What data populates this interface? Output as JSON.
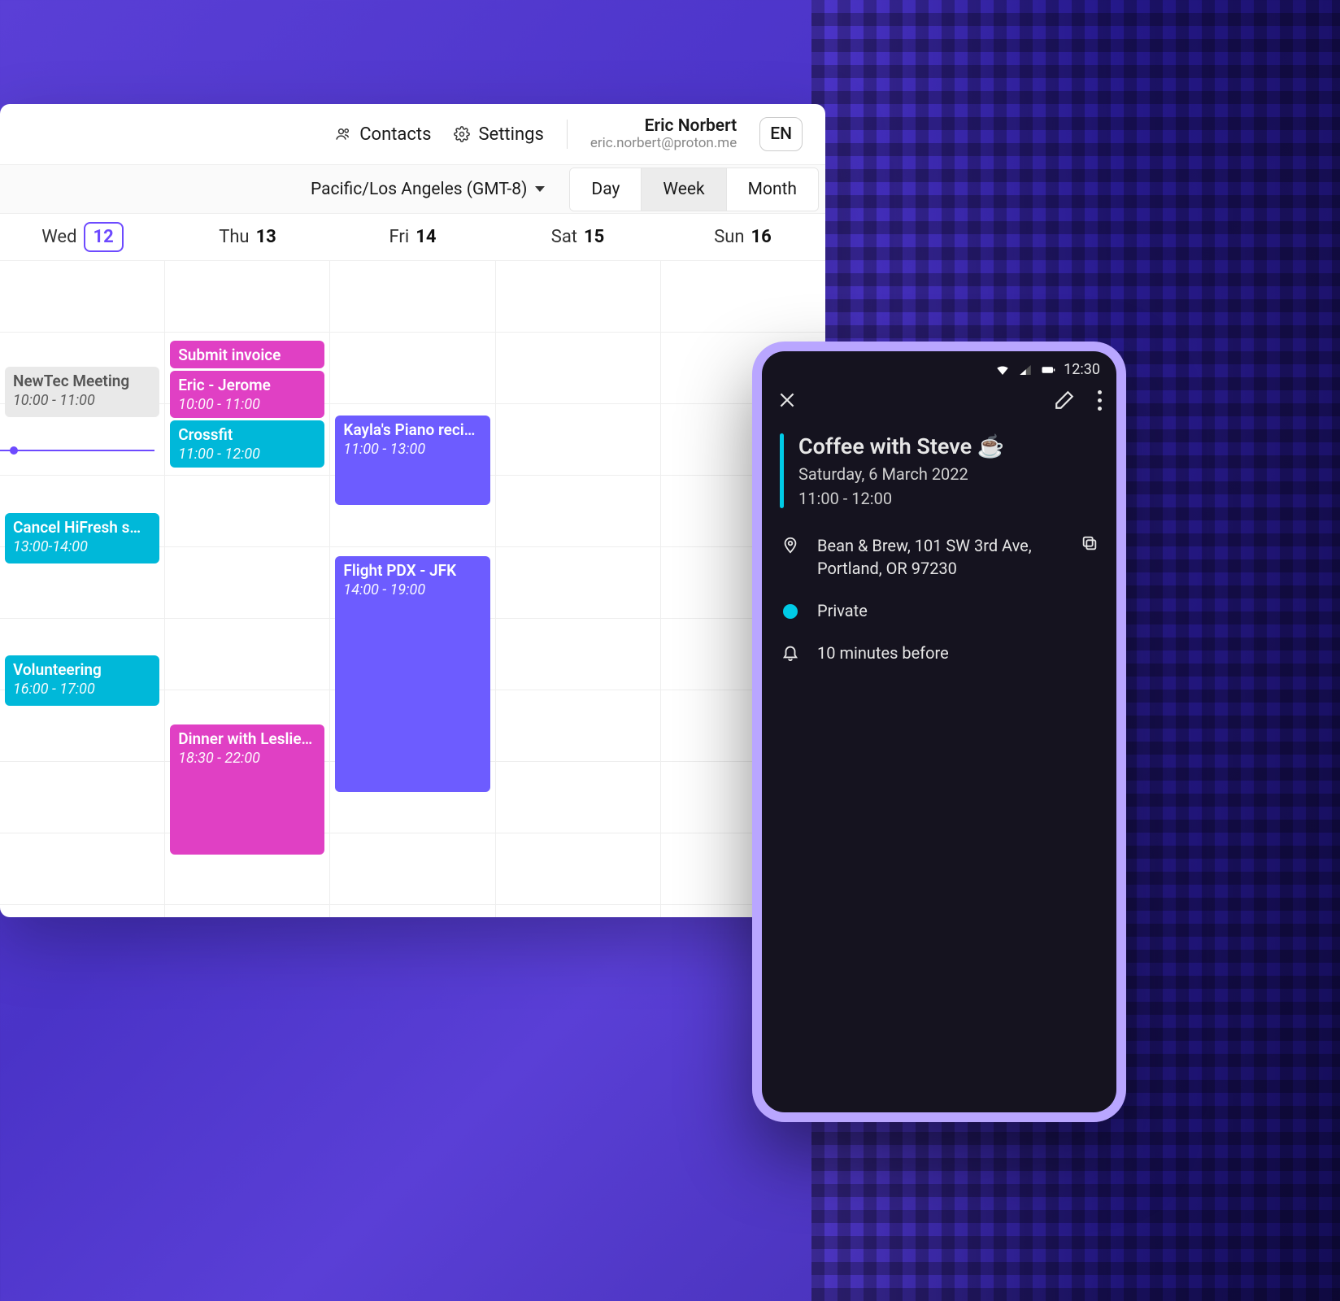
{
  "header": {
    "contacts": "Contacts",
    "settings": "Settings",
    "user_name": "Eric Norbert",
    "user_email": "eric.norbert@proton.me",
    "lang": "EN"
  },
  "toolbar": {
    "timezone": "Pacific/Los Angeles (GMT-8)",
    "views": {
      "day": "Day",
      "week": "Week",
      "month": "Month"
    },
    "active_view": "week"
  },
  "days": [
    {
      "label": "Wed",
      "num": "12",
      "today": true
    },
    {
      "label": "Thu",
      "num": "13",
      "today": false
    },
    {
      "label": "Fri",
      "num": "14",
      "today": false
    },
    {
      "label": "Sat",
      "num": "15",
      "today": false
    },
    {
      "label": "Sun",
      "num": "16",
      "today": false
    }
  ],
  "events": {
    "newtec": {
      "title": "NewTec Meeting",
      "time": "10:00 - 11:00"
    },
    "cancel": {
      "title": "Cancel HiFresh s…",
      "time": "13:00-14:00"
    },
    "volun": {
      "title": "Volunteering",
      "time": "16:00 - 17:00"
    },
    "submit": {
      "title": "Submit invoice",
      "time": ""
    },
    "eric": {
      "title": "Eric - Jerome",
      "time": "10:00 - 11:00"
    },
    "crossfit": {
      "title": "Crossfit",
      "time": "11:00 - 12:00"
    },
    "dinner": {
      "title": "Dinner with Leslie…",
      "time": "18:30 - 22:00"
    },
    "piano": {
      "title": "Kayla's Piano reci…",
      "time": "11:00 - 13:00"
    },
    "flight": {
      "title": "Flight PDX - JFK",
      "time": "14:00 - 19:00"
    }
  },
  "phone": {
    "status_time": "12:30",
    "title": "Coffee with Steve ☕",
    "date": "Saturday, 6 March 2022",
    "time": "11:00 - 12:00",
    "location": "Bean & Brew, 101 SW 3rd Ave, Portland, OR 97230",
    "visibility": "Private",
    "reminder": "10 minutes before"
  }
}
